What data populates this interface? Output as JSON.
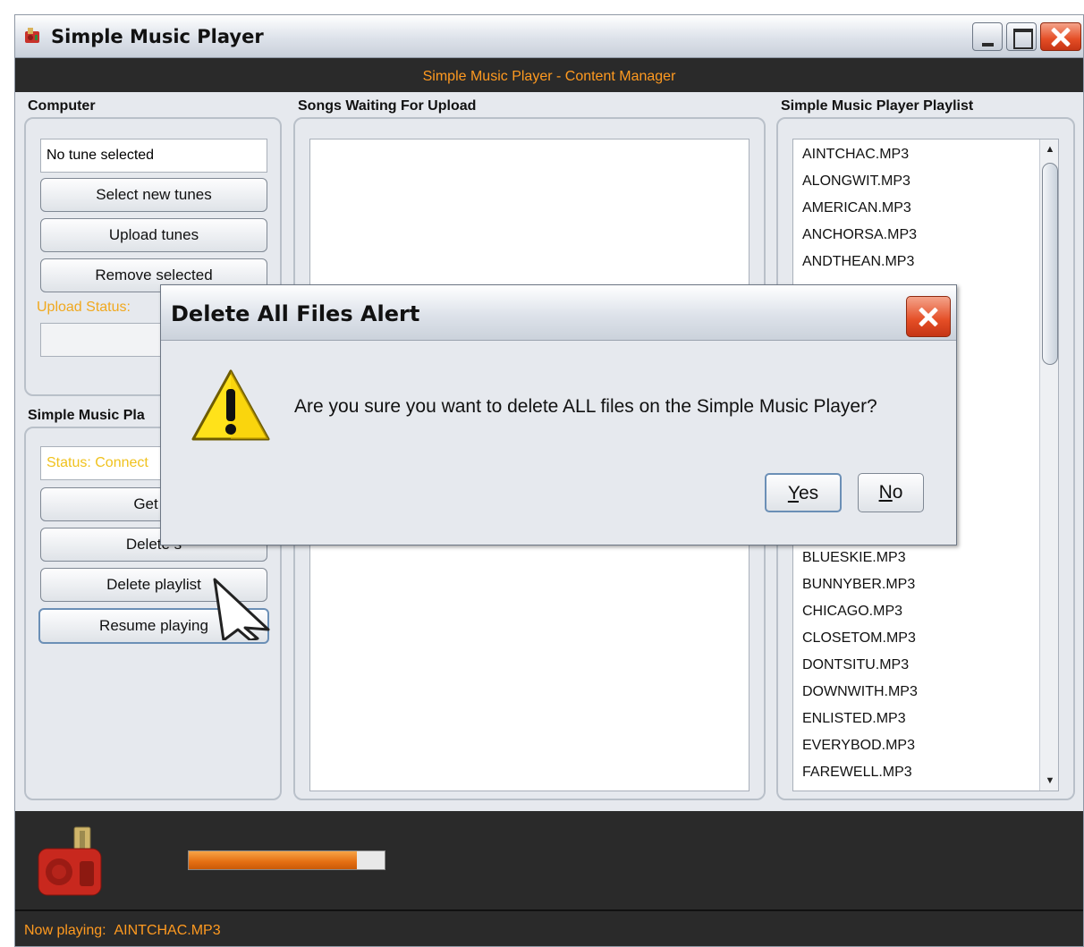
{
  "window": {
    "title": "Simple Music Player",
    "header": "Simple Music Player - Content Manager"
  },
  "computer": {
    "label": "Computer",
    "selected_tune": "No tune selected",
    "select_button": "Select new tunes",
    "upload_button": "Upload tunes",
    "remove_button": "Remove selected",
    "upload_status_label": "Upload Status:"
  },
  "device": {
    "label": "Simple Music Pla",
    "status": "Status: Connect",
    "get_playlist_button": "Get pl",
    "delete_selected_button": "Delete s",
    "delete_playlist_button": "Delete playlist",
    "resume_button": "Resume playing"
  },
  "upload_queue": {
    "label": "Songs Waiting For Upload",
    "items": []
  },
  "playlist": {
    "label": "Simple Music Player Playlist",
    "items_top": [
      "AINTCHAC.MP3",
      "ALONGWIT.MP3",
      "AMERICAN.MP3",
      "ANCHORSA.MP3",
      "ANDTHEAN.MP3"
    ],
    "items_bottom": [
      "BLUESKIE.MP3",
      "BUNNYBER.MP3",
      "CHICAGO.MP3",
      "CLOSETOM.MP3",
      "DONTSITU.MP3",
      "DOWNWITH.MP3",
      "ENLISTED.MP3",
      "EVERYBOD.MP3",
      "FAREWELL.MP3"
    ]
  },
  "footer": {
    "now_playing_label": "Now playing:",
    "now_playing_track": "AINTCHAC.MP3",
    "progress": 0.86
  },
  "dialog": {
    "title": "Delete All Files Alert",
    "message": "Are you sure you want to delete ALL files on the Simple Music Player?",
    "yes_mnemonic": "Y",
    "yes_rest": "es",
    "no_mnemonic": "N",
    "no_rest": "o"
  },
  "colors": {
    "accent": "#ff9a20",
    "header_bg": "#2a2a2a",
    "window_bg": "#e6e9ee"
  },
  "icons": [
    "app-icon",
    "minimize-icon",
    "maximize-icon",
    "close-icon",
    "warning-icon",
    "radio-icon",
    "mouse-cursor-icon"
  ]
}
